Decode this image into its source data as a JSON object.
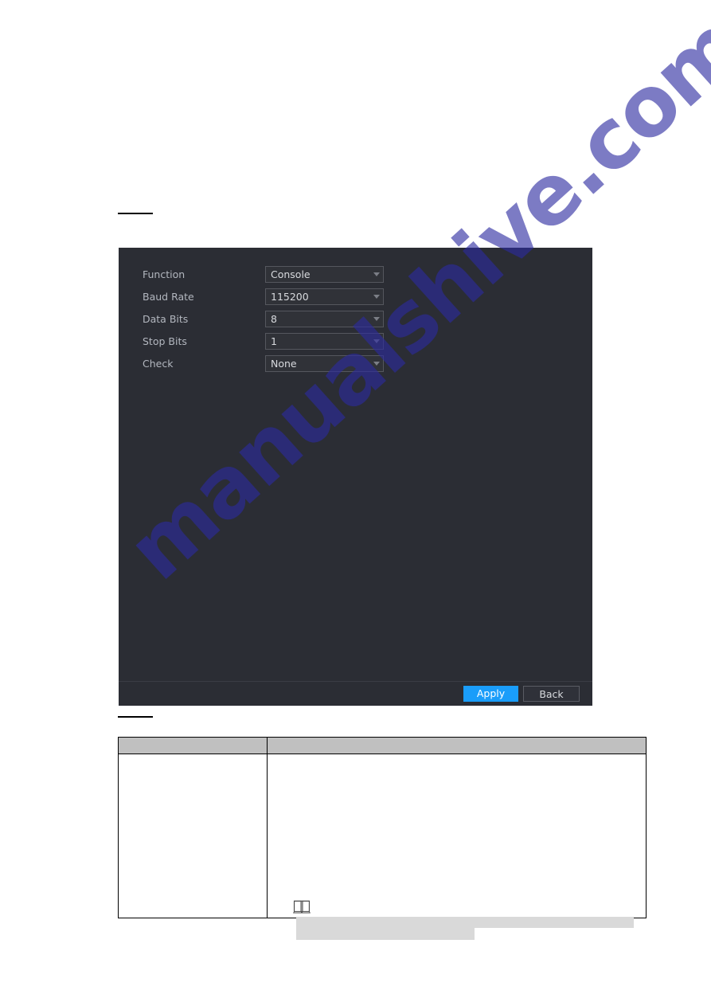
{
  "page": {
    "background_color": "#ffffff",
    "figure_caption_rule": true,
    "table_caption_rule": true
  },
  "watermark": {
    "text": "manualshive.com",
    "color": "#2c2aa0",
    "rotation_deg": -42
  },
  "dialog": {
    "name": "serial-port-settings",
    "background_color": "#2b2d34",
    "fields": [
      {
        "label": "Function",
        "value": "Console",
        "control": "dropdown",
        "icon": "chevron-down-icon"
      },
      {
        "label": "Baud Rate",
        "value": "115200",
        "control": "dropdown",
        "icon": "chevron-down-icon"
      },
      {
        "label": "Data Bits",
        "value": "8",
        "control": "dropdown",
        "icon": "chevron-down-icon"
      },
      {
        "label": "Stop Bits",
        "value": "1",
        "control": "dropdown",
        "icon": "chevron-down-icon"
      },
      {
        "label": "Check",
        "value": "None",
        "control": "dropdown",
        "icon": "chevron-down-icon"
      }
    ],
    "footer": {
      "apply_label": "Apply",
      "apply_color": "#1a9dfa",
      "back_label": "Back"
    }
  },
  "param_table": {
    "header_background": "#c0c0c0",
    "columns": [
      {
        "header": ""
      },
      {
        "header": ""
      }
    ],
    "rows": [
      {
        "name": "",
        "description": ""
      }
    ],
    "note": {
      "icon": "note-book-icon",
      "redacted_lines": 2,
      "redaction_color": "#d9d9d9"
    }
  }
}
